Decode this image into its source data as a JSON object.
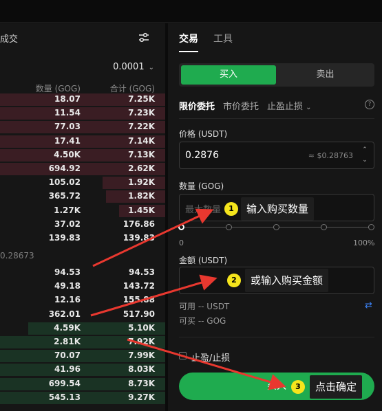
{
  "orderbook": {
    "title": "成交",
    "precision": "0.0001",
    "header_qty": "数量 (GOG)",
    "header_sum": "合计 (GOG)",
    "mid_price": "0.28673",
    "asks": [
      {
        "qty": "18.07",
        "sum": "7.25K",
        "depth": 1.0
      },
      {
        "qty": "11.54",
        "sum": "7.23K",
        "depth": 1.0
      },
      {
        "qty": "77.03",
        "sum": "7.22K",
        "depth": 1.0
      },
      {
        "qty": "17.41",
        "sum": "7.14K",
        "depth": 1.0
      },
      {
        "qty": "4.50K",
        "sum": "7.13K",
        "depth": 1.0
      },
      {
        "qty": "694.92",
        "sum": "2.62K",
        "depth": 1.0
      },
      {
        "qty": "105.02",
        "sum": "1.92K",
        "depth": 0.38
      },
      {
        "qty": "365.72",
        "sum": "1.82K",
        "depth": 0.36
      },
      {
        "qty": "1.27K",
        "sum": "1.45K",
        "depth": 0.28
      },
      {
        "qty": "37.02",
        "sum": "176.86",
        "depth": 0.0
      },
      {
        "qty": "139.83",
        "sum": "139.83",
        "depth": 0.0
      }
    ],
    "bids": [
      {
        "qty": "94.53",
        "sum": "94.53",
        "depth": 0.0
      },
      {
        "qty": "49.18",
        "sum": "143.72",
        "depth": 0.0
      },
      {
        "qty": "12.16",
        "sum": "155.88",
        "depth": 0.0
      },
      {
        "qty": "362.01",
        "sum": "517.90",
        "depth": 0.0
      },
      {
        "qty": "4.59K",
        "sum": "5.10K",
        "depth": 0.83
      },
      {
        "qty": "2.81K",
        "sum": "7.92K",
        "depth": 1.0
      },
      {
        "qty": "70.07",
        "sum": "7.99K",
        "depth": 1.0
      },
      {
        "qty": "41.96",
        "sum": "8.03K",
        "depth": 1.0
      },
      {
        "qty": "699.54",
        "sum": "8.73K",
        "depth": 1.0
      },
      {
        "qty": "545.13",
        "sum": "9.27K",
        "depth": 1.0
      }
    ]
  },
  "trade": {
    "tab_trade": "交易",
    "tab_tools": "工具",
    "buy": "买入",
    "sell": "卖出",
    "order_types": {
      "limit": "限价委托",
      "market": "市价委托",
      "stop": "止盈止损"
    },
    "help": "?",
    "price_label": "价格 (USDT)",
    "price_value": "0.2876",
    "price_sub": "≈ $0.28763",
    "qty_label": "数量 (GOG)",
    "qty_placeholder": "最大数量 0",
    "slider_percent": 0,
    "pct_min": "0",
    "pct_max": "100%",
    "amount_label": "金额 (USDT)",
    "available": "可用 -- USDT",
    "can_buy": "可买 -- GOG",
    "tpsl": "止盈/止损",
    "confirm": "买入"
  },
  "annotations": {
    "step1": "输入购买数量",
    "step2": "或输入购买金额",
    "step3": "点击确定",
    "n1": "1",
    "n2": "2",
    "n3": "3",
    "arrow_color": "#e8382f",
    "badge_color": "#f5e51c"
  }
}
